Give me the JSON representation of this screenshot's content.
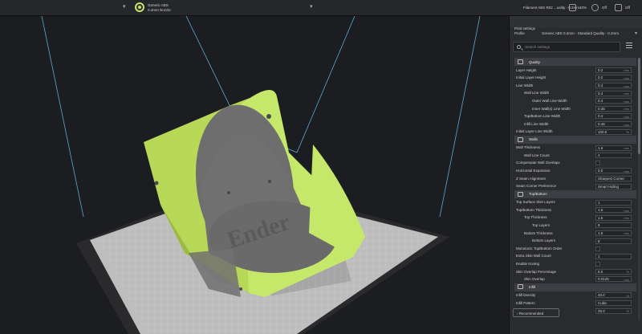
{
  "topbar": {
    "printer_name": "Generic ABS",
    "nozzle": "0.4mm Nozzle",
    "profile_summary": "Filament ABS R02 ...uality - 0.2mm",
    "support_label": "40%",
    "adhesion_label": "Off",
    "extra_label": "Off"
  },
  "panel": {
    "header_title": "Print settings",
    "profile_label": "Profile",
    "profile_value": "Generic ABS 0.2mm - Standard Quality - 0.2mm",
    "search_placeholder": "Search settings",
    "recommended_label": "Recommended",
    "categories": [
      {
        "label": "Quality",
        "icon": "quality-icon"
      },
      {
        "label": "Walls",
        "icon": "walls-icon"
      },
      {
        "label": "Top/Bottom",
        "icon": "topbottom-icon"
      },
      {
        "label": "Infill",
        "icon": "infill-icon"
      }
    ],
    "quality_rows": [
      {
        "label": "Layer Height",
        "value": "0.2",
        "unit": "mm"
      },
      {
        "label": "Initial Layer Height",
        "value": "0.2",
        "unit": "mm"
      },
      {
        "label": "Line Width",
        "value": "0.4",
        "unit": "mm"
      },
      {
        "label": "Wall Line Width",
        "value": "0.4",
        "unit": "mm"
      },
      {
        "label": "Outer Wall Line Width",
        "value": "0.4",
        "unit": "mm"
      },
      {
        "label": "Inner Wall(s) Line Width",
        "value": "0.35",
        "unit": "mm"
      },
      {
        "label": "Top/Bottom Line Width",
        "value": "0.4",
        "unit": "mm"
      },
      {
        "label": "Infill Line Width",
        "value": "0.45",
        "unit": "mm"
      },
      {
        "label": "Initial Layer Line Width",
        "value": "100.0",
        "unit": "%"
      }
    ],
    "walls_rows": [
      {
        "label": "Wall Thickness",
        "value": "1.6",
        "unit": "mm"
      },
      {
        "label": "Wall Line Count",
        "value": "4",
        "unit": ""
      },
      {
        "label": "Compensate Wall Overlaps",
        "value": "",
        "unit": ""
      },
      {
        "label": "Horizontal Expansion",
        "value": "0.0",
        "unit": "mm"
      },
      {
        "label": "Z Seam Alignment",
        "value": "Sharpest Corner",
        "unit": ""
      },
      {
        "label": "Seam Corner Preference",
        "value": "Smart Hiding",
        "unit": ""
      }
    ],
    "topbottom_rows": [
      {
        "label": "Top Surface Skin Layers",
        "value": "1",
        "unit": ""
      },
      {
        "label": "Top/Bottom Thickness",
        "value": "1.6",
        "unit": "mm"
      },
      {
        "label": "Top Thickness",
        "value": "1.6",
        "unit": "mm"
      },
      {
        "label": "Top Layers",
        "value": "8",
        "unit": ""
      },
      {
        "label": "Bottom Thickness",
        "value": "1.6",
        "unit": "mm"
      },
      {
        "label": "Bottom Layers",
        "value": "8",
        "unit": ""
      },
      {
        "label": "Monotonic Top/Bottom Order",
        "value": "",
        "unit": ""
      },
      {
        "label": "Extra Skin Wall Count",
        "value": "1",
        "unit": ""
      },
      {
        "label": "Enable Ironing",
        "value": "",
        "unit": ""
      },
      {
        "label": "Skin Overlap Percentage",
        "value": "5.0",
        "unit": "%"
      },
      {
        "label": "Skin Overlap",
        "value": "0.0125",
        "unit": "mm"
      }
    ],
    "infill_rows": [
      {
        "label": "Infill Density",
        "value": "40.0",
        "unit": "%"
      },
      {
        "label": "Infill Pattern",
        "value": "Cubic",
        "unit": ""
      },
      {
        "label": "Infill Overlap Percentage",
        "value": "25.0",
        "unit": "%"
      }
    ]
  },
  "viewport": {
    "model_color": "#c5e86a",
    "plate_label": "Ender"
  }
}
